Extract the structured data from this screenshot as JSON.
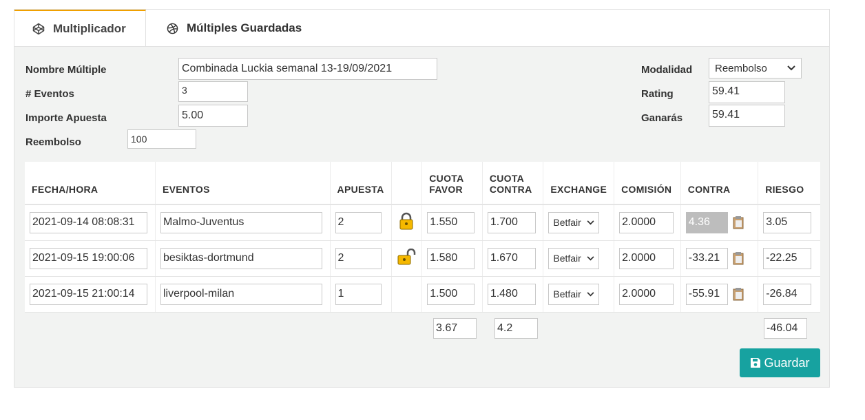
{
  "tabs": [
    {
      "label": "Multiplicador",
      "icon": "codepen-icon",
      "active": true
    },
    {
      "label": "Múltiples Guardadas",
      "icon": "dribbble-icon",
      "active": false
    }
  ],
  "form": {
    "nombre_label": "Nombre Múltiple",
    "nombre_value": "Combinada Luckia semanal 13-19/09/2021",
    "eventos_label": "# Eventos",
    "eventos_value": "3",
    "importe_label": "Importe Apuesta",
    "importe_value": "5.00",
    "reembolso_label": "Reembolso",
    "reembolso_value": "100",
    "modalidad_label": "Modalidad",
    "modalidad_value": "Reembolso",
    "rating_label": "Rating",
    "rating_value": "59.41",
    "ganaras_label": "Ganarás",
    "ganaras_value": "59.41"
  },
  "table": {
    "headers": {
      "fecha": "FECHA/HORA",
      "eventos": "EVENTOS",
      "apuesta": "APUESTA",
      "lock": "",
      "cuota_favor_1": "CUOTA",
      "cuota_favor_2": "FAVOR",
      "cuota_contra_1": "CUOTA",
      "cuota_contra_2": "CONTRA",
      "exchange": "EXCHANGE",
      "comision": "COMISIÓN",
      "contra": "CONTRA",
      "riesgo": "RIESGO"
    },
    "rows": [
      {
        "fecha": "2021-09-14 08:08:31",
        "evento": "Malmo-Juventus",
        "apuesta": "2",
        "lock": "locked",
        "cuota_favor": "1.550",
        "cuota_contra": "1.700",
        "exchange": "Betfair",
        "comision": "2.0000",
        "contra": "4.36",
        "riesgo": "3.05"
      },
      {
        "fecha": "2021-09-15 19:00:06",
        "evento": "besiktas-dortmund",
        "apuesta": "2",
        "lock": "unlocked",
        "cuota_favor": "1.580",
        "cuota_contra": "1.670",
        "exchange": "Betfair",
        "comision": "2.0000",
        "contra": "-33.21",
        "riesgo": "-22.25"
      },
      {
        "fecha": "2021-09-15 21:00:14",
        "evento": "liverpool-milan",
        "apuesta": "1",
        "lock": "none",
        "cuota_favor": "1.500",
        "cuota_contra": "1.480",
        "exchange": "Betfair",
        "comision": "2.0000",
        "contra": "-55.91",
        "riesgo": "-26.84"
      }
    ],
    "totals": {
      "cuota_favor": "3.67",
      "cuota_contra": "4.2",
      "riesgo": "-46.04"
    }
  },
  "actions": {
    "save_label": "Guardar"
  },
  "colors": {
    "accent_tab": "#f0a000",
    "save_button": "#17a2a0",
    "panel_bg": "#f2f3f2",
    "lock_icon": "#f5b800"
  }
}
